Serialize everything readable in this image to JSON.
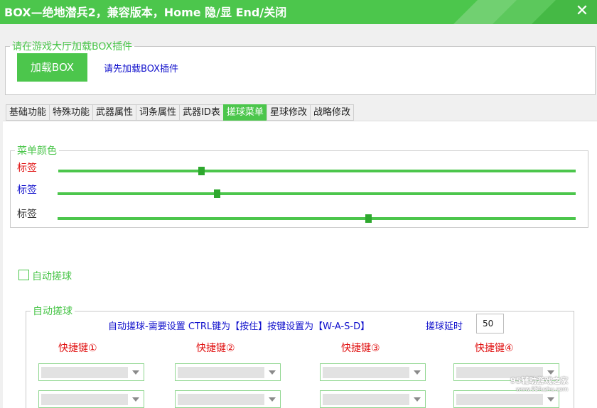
{
  "titlebar": {
    "title": "BOX—绝地潜兵2，兼容版本，Home 隐/显  End/关闭",
    "close_glyph": "✕"
  },
  "loader": {
    "legend": "请在游戏大厅加载BOX插件",
    "button_label": "加载BOX",
    "hint": "请先加载BOX插件"
  },
  "tabs": [
    {
      "label": "基础功能",
      "active": false
    },
    {
      "label": "特殊功能",
      "active": false
    },
    {
      "label": "武器属性",
      "active": false
    },
    {
      "label": "词条属性",
      "active": false
    },
    {
      "label": "武器ID表",
      "active": false
    },
    {
      "label": "搓球菜单",
      "active": true
    },
    {
      "label": "星球修改",
      "active": false
    },
    {
      "label": "战略修改",
      "active": false
    }
  ],
  "menu_color": {
    "legend": "菜单颜色",
    "sliders": [
      {
        "label": "标签",
        "label_color": "#e01010",
        "value": 0.276
      },
      {
        "label": "标签",
        "label_color": "#1010cc",
        "value": 0.307
      },
      {
        "label": "标签",
        "label_color": "#333333",
        "value": 0.599
      }
    ]
  },
  "auto_ball_checkbox": {
    "label": "自动搓球",
    "checked": false
  },
  "auto_ball": {
    "legend": "自动搓球",
    "description": "自动搓球-需要设置 CTRL键为【按住】按键设置为【W-A-S-D】",
    "delay_label": "搓球延时",
    "delay_value": "50",
    "hotkeys": [
      "快捷键①",
      "快捷键②",
      "快捷键③",
      "快捷键④"
    ]
  },
  "watermark": {
    "main": "95辅助游戏之家",
    "sub": "www.95fuzhu.com"
  },
  "colors": {
    "accent": "#4cc64c",
    "blue_text": "#1010cc",
    "red_text": "#e01010"
  }
}
